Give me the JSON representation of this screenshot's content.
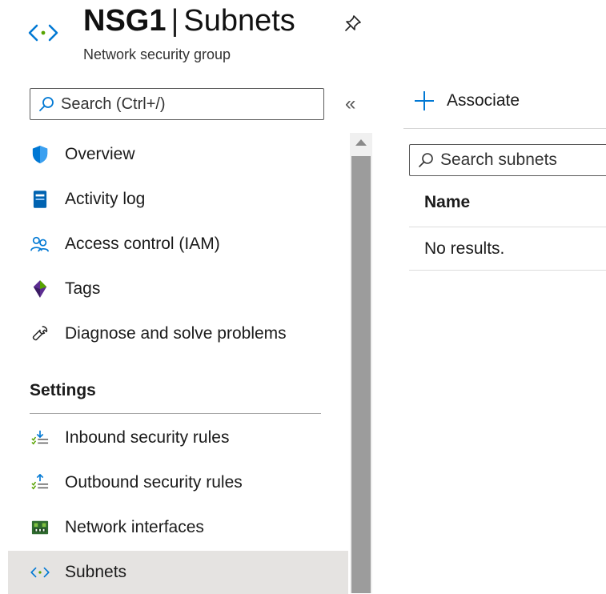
{
  "header": {
    "resource_name": "NSG1",
    "separator": "|",
    "blade_title": "Subnets",
    "subtitle": "Network security group",
    "pin_icon": "pin-icon",
    "resource_icon": "subnet-icon"
  },
  "sidebar": {
    "search_placeholder": "Search (Ctrl+/)",
    "collapse_glyph": "«",
    "items": [
      {
        "label": "Overview",
        "icon": "shield-icon"
      },
      {
        "label": "Activity log",
        "icon": "activity-log-icon"
      },
      {
        "label": "Access control (IAM)",
        "icon": "users-icon"
      },
      {
        "label": "Tags",
        "icon": "tag-icon"
      },
      {
        "label": "Diagnose and solve problems",
        "icon": "wrench-icon"
      }
    ],
    "settings_heading": "Settings",
    "settings_items": [
      {
        "label": "Inbound security rules",
        "icon": "inbound-rules-icon"
      },
      {
        "label": "Outbound security rules",
        "icon": "outbound-rules-icon"
      },
      {
        "label": "Network interfaces",
        "icon": "network-interface-icon"
      },
      {
        "label": "Subnets",
        "icon": "subnet-icon",
        "selected": true
      }
    ]
  },
  "toolbar": {
    "associate_label": "Associate"
  },
  "main": {
    "search_placeholder": "Search subnets",
    "columns": [
      "Name"
    ],
    "empty_text": "No results."
  },
  "colors": {
    "accent": "#0078d4",
    "selected_bg": "#e5e3e1",
    "scroll_thumb": "#9c9c9c"
  }
}
